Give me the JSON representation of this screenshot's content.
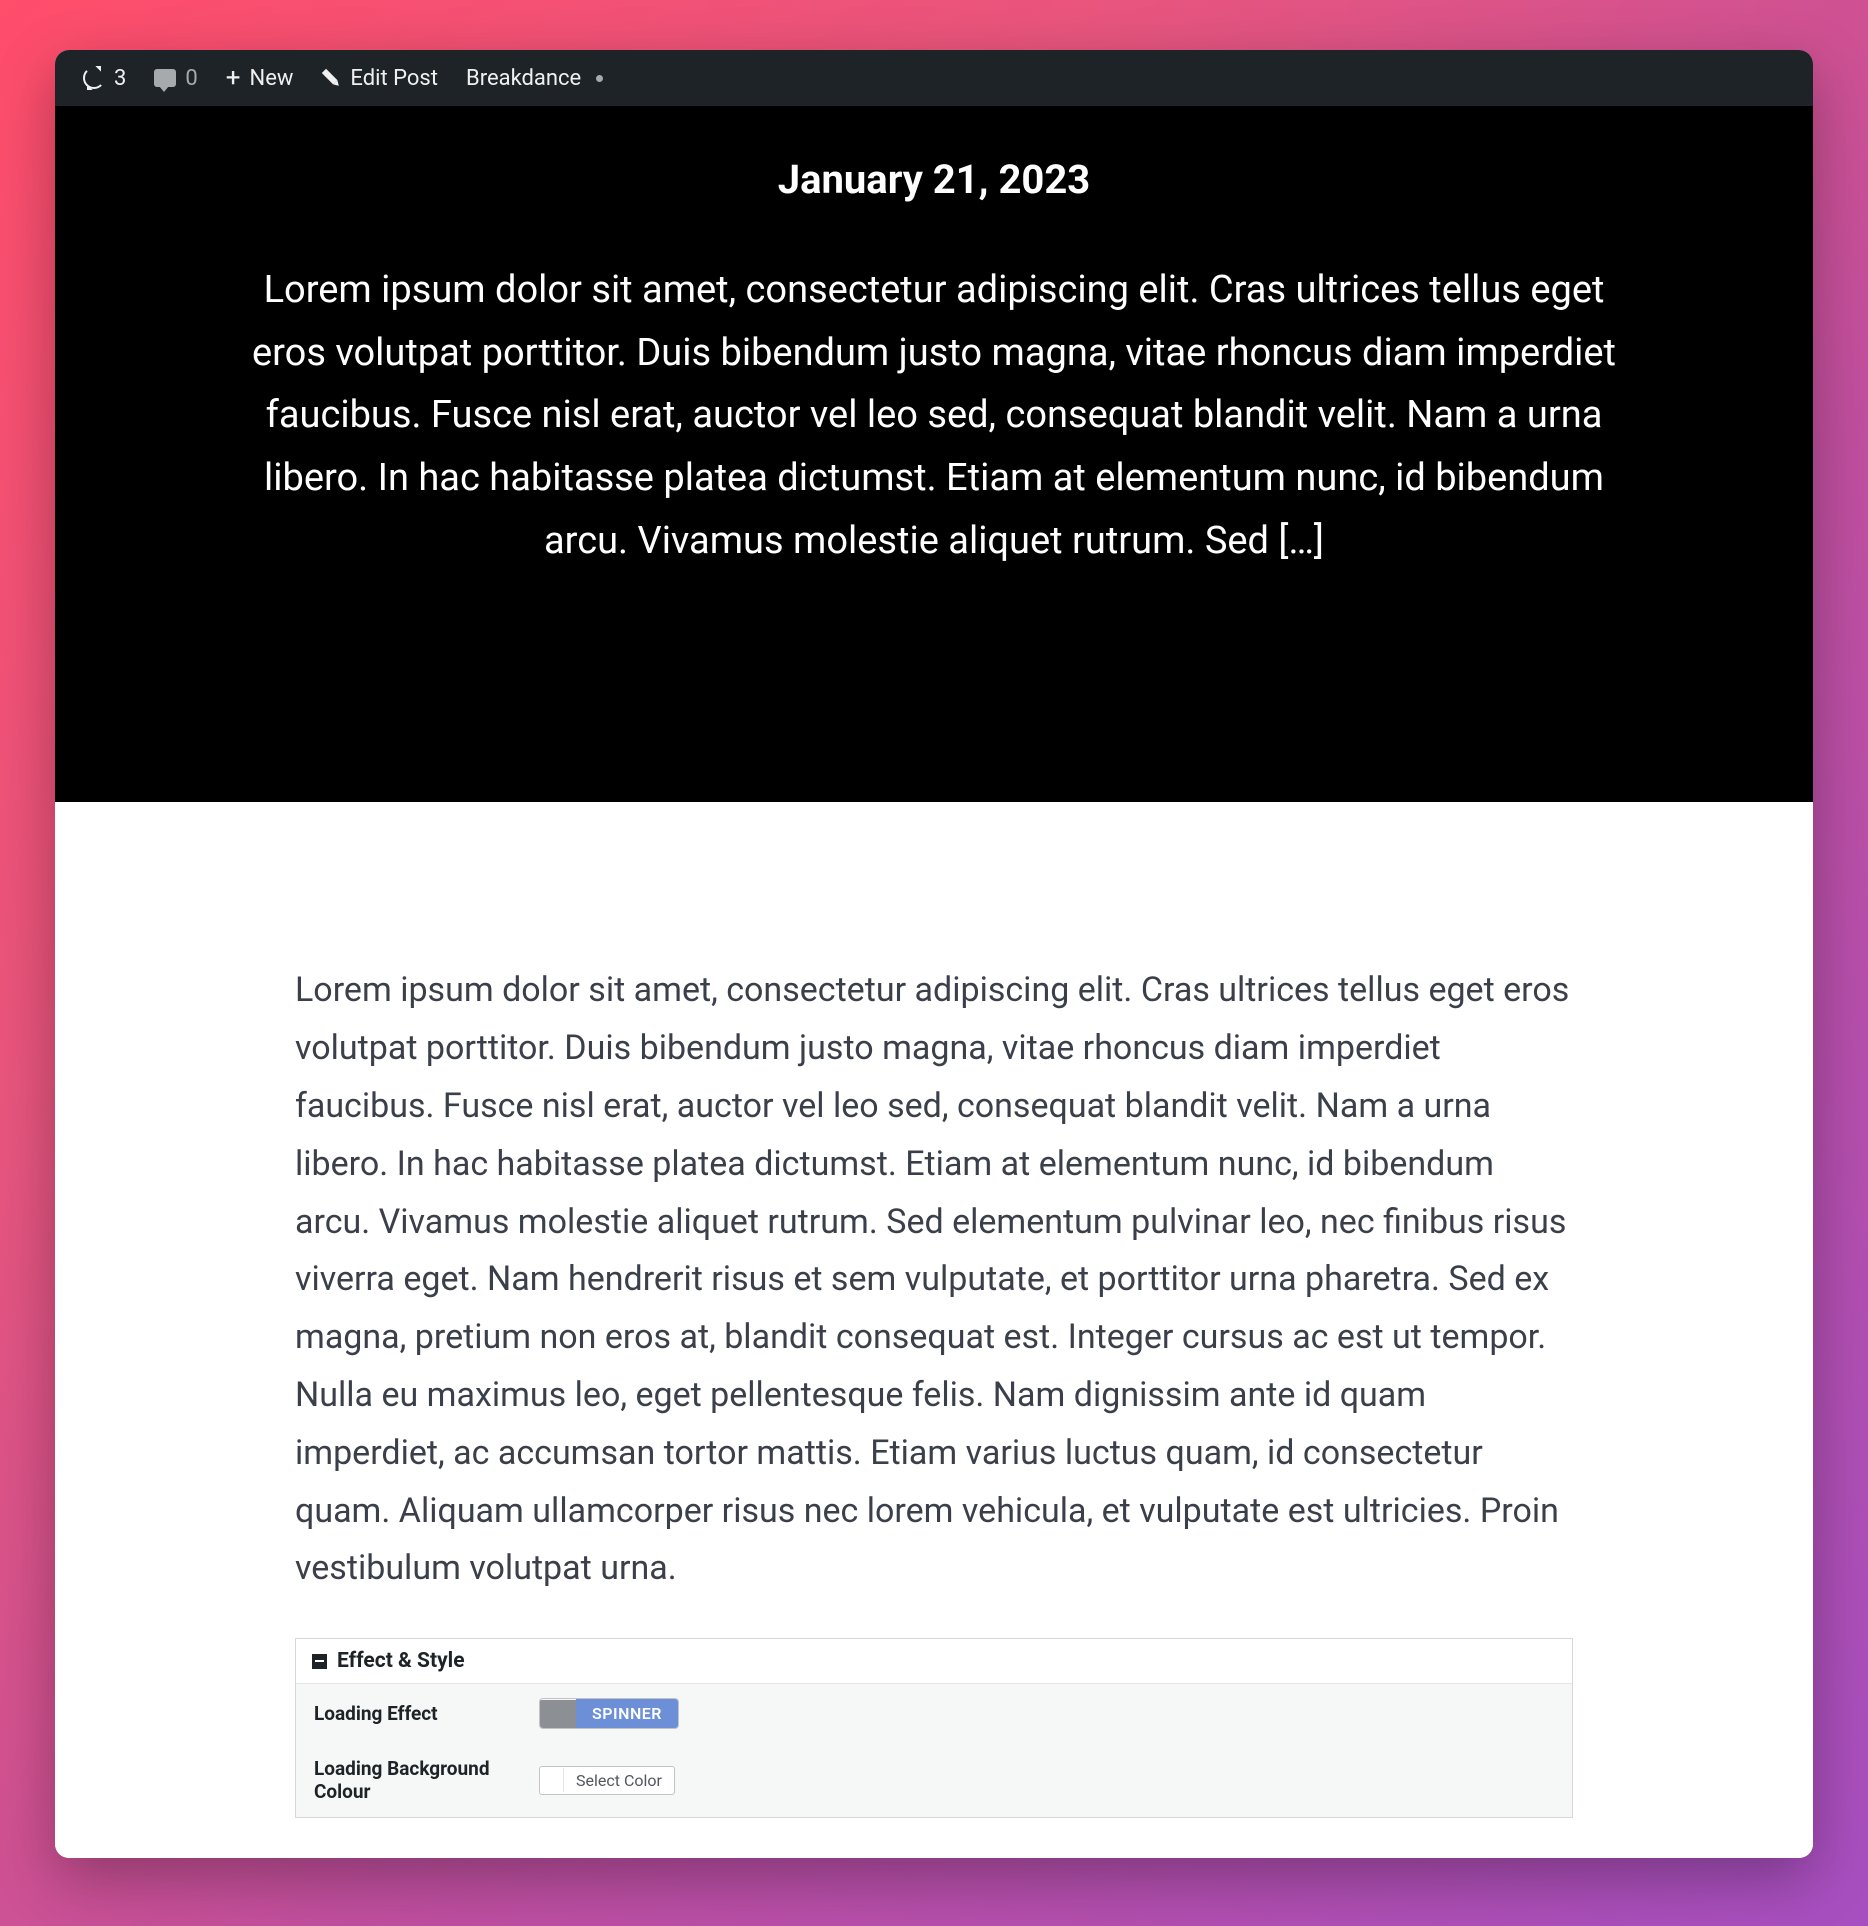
{
  "adminBar": {
    "refreshCount": "3",
    "commentCount": "0",
    "newLabel": "New",
    "editPostLabel": "Edit Post",
    "breakdanceLabel": "Breakdance"
  },
  "hero": {
    "date": "January 21, 2023",
    "excerpt": "Lorem ipsum dolor sit amet, consectetur adipiscing elit. Cras ultrices tellus eget eros volutpat porttitor. Duis bibendum justo magna, vitae rhoncus diam imperdiet faucibus. Fusce nisl erat, auctor vel leo sed, consequat blandit velit. Nam a urna libero. In hac habitasse platea dictumst. Etiam at elementum nunc, id bibendum arcu. Vivamus molestie aliquet rutrum. Sed […]"
  },
  "content": {
    "body": "Lorem ipsum dolor sit amet, consectetur adipiscing elit. Cras ultrices tellus eget eros volutpat porttitor. Duis bibendum justo magna, vitae rhoncus diam imperdiet faucibus. Fusce nisl erat, auctor vel leo sed, consequat blandit velit. Nam a urna libero. In hac habitasse platea dictumst. Etiam at elementum nunc, id bibendum arcu. Vivamus molestie aliquet rutrum. Sed elementum pulvinar leo, nec finibus risus viverra eget. Nam hendrerit risus et sem vulputate, et porttitor urna pharetra. Sed ex magna, pretium non eros at, blandit consequat est. Integer cursus ac est ut tempor. Nulla eu maximus leo, eget pellentesque felis. Nam dignissim ante id quam imperdiet, ac accumsan tortor mattis. Etiam varius luctus quam, id consectetur quam. Aliquam ullamcorper risus nec lorem vehicula, et vulputate est ultricies. Proin vestibulum volutpat urna."
  },
  "settings": {
    "panelTitle": "Effect & Style",
    "loadingEffectLabel": "Loading Effect",
    "loadingEffectValue": "SPINNER",
    "loadingBgLabel": "Loading Background Colour",
    "selectColorLabel": "Select Color"
  }
}
